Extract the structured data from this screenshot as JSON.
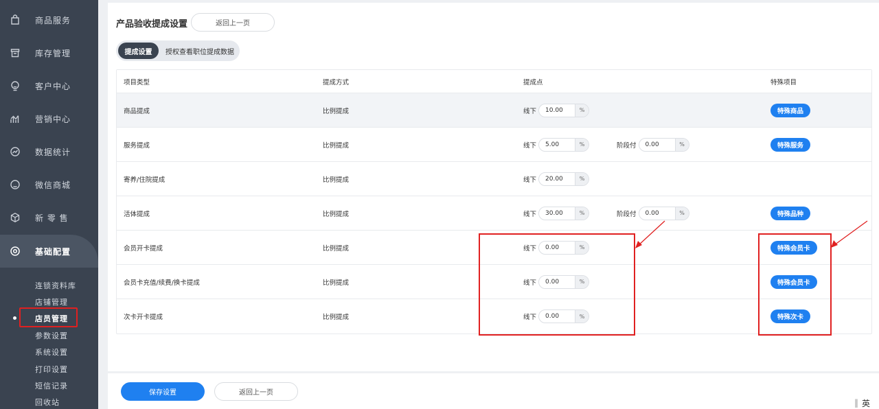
{
  "sidebar": {
    "items": [
      {
        "label": "商品服务",
        "icon": "bag-icon"
      },
      {
        "label": "库存管理",
        "icon": "box-icon"
      },
      {
        "label": "客户中心",
        "icon": "customer-icon"
      },
      {
        "label": "营销中心",
        "icon": "chart-icon"
      },
      {
        "label": "数据统计",
        "icon": "stats-icon"
      },
      {
        "label": "微信商城",
        "icon": "wechat-icon"
      },
      {
        "label": "新 零 售",
        "icon": "cube-icon"
      },
      {
        "label": "基础配置",
        "icon": "settings-icon"
      }
    ],
    "subitems": [
      "连锁资料库",
      "店铺管理",
      "店员管理",
      "参数设置",
      "系统设置",
      "打印设置",
      "短信记录",
      "回收站"
    ],
    "active_subitem": "店员管理"
  },
  "header": {
    "title": "产品验收提成设置",
    "back_label": "返回上一页"
  },
  "tabs": [
    "提成设置",
    "授权查看职位提成数据"
  ],
  "table": {
    "headers": [
      "项目类型",
      "提成方式",
      "提成点",
      "特殊项目"
    ],
    "offline_label": "线下",
    "stage_label": "阶段付",
    "unit": "%",
    "rows": [
      {
        "type": "商品提成",
        "method": "比例提成",
        "offline": "10.00",
        "stage": null,
        "special": "特殊商品"
      },
      {
        "type": "服务提成",
        "method": "比例提成",
        "offline": "5.00",
        "stage": "0.00",
        "special": "特殊服务"
      },
      {
        "type": "寄养/住院提成",
        "method": "比例提成",
        "offline": "20.00",
        "stage": null,
        "special": null
      },
      {
        "type": "活体提成",
        "method": "比例提成",
        "offline": "30.00",
        "stage": "0.00",
        "special": "特殊品种"
      },
      {
        "type": "会员开卡提成",
        "method": "比例提成",
        "offline": "0.00",
        "stage": null,
        "special": "特殊会员卡"
      },
      {
        "type": "会员卡充值/续费/换卡提成",
        "method": "比例提成",
        "offline": "0.00",
        "stage": null,
        "special": "特殊会员卡"
      },
      {
        "type": "次卡开卡提成",
        "method": "比例提成",
        "offline": "0.00",
        "stage": null,
        "special": "特殊次卡"
      }
    ]
  },
  "footer": {
    "save_label": "保存设置",
    "back_label": "返回上一页"
  },
  "ime": {
    "label": "英"
  },
  "colors": {
    "sidebar_bg": "#3a4350",
    "primary": "#1f80f0",
    "annotation": "#e02020"
  }
}
